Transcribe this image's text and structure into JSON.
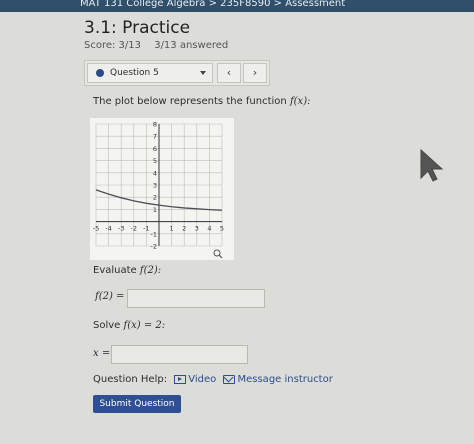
{
  "topbar": {
    "breadcrumb": "MAT 131 College Algebra > 235F8590 > Assessment"
  },
  "page": {
    "title": "3.1: Practice",
    "score": "Score: 3/13",
    "answered": "3/13 answered"
  },
  "question_nav": {
    "selected": "Question 5",
    "prev": "‹",
    "next": "›"
  },
  "prompt": {
    "text": "The plot below represents the function",
    "func": "f(x):"
  },
  "chart_data": {
    "type": "line",
    "x_ticks": [
      "-5",
      "-4",
      "-3",
      "-2",
      "-1",
      "1",
      "2",
      "3",
      "4",
      "5"
    ],
    "y_ticks": [
      "-2",
      "-1",
      "1",
      "2",
      "3",
      "4",
      "5",
      "6",
      "7",
      "8"
    ],
    "xlim": [
      -5,
      5
    ],
    "ylim": [
      -2,
      8
    ],
    "grid": true,
    "series": [
      {
        "x": [
          -5,
          -4,
          -3,
          -2,
          -1,
          0,
          1,
          2,
          3,
          4,
          5
        ],
        "y": [
          2.6,
          2.25,
          1.95,
          1.7,
          1.5,
          1.35,
          1.22,
          1.12,
          1.05,
          0.98,
          0.93
        ]
      }
    ],
    "colors": {
      "curve": "#4a4f58",
      "grid": "#bdbdb8",
      "axis": "#333333"
    }
  },
  "evaluate": {
    "label": "Evaluate",
    "expr": "f(2):"
  },
  "answer1": {
    "label": "f(2) =",
    "value": ""
  },
  "solve": {
    "label": "Solve",
    "expr": "f(x) = 2:"
  },
  "answer2": {
    "label": "x =",
    "value": ""
  },
  "help": {
    "label": "Question Help:",
    "video": "Video",
    "message": "Message instructor"
  },
  "submit": {
    "label": "Submit Question"
  }
}
